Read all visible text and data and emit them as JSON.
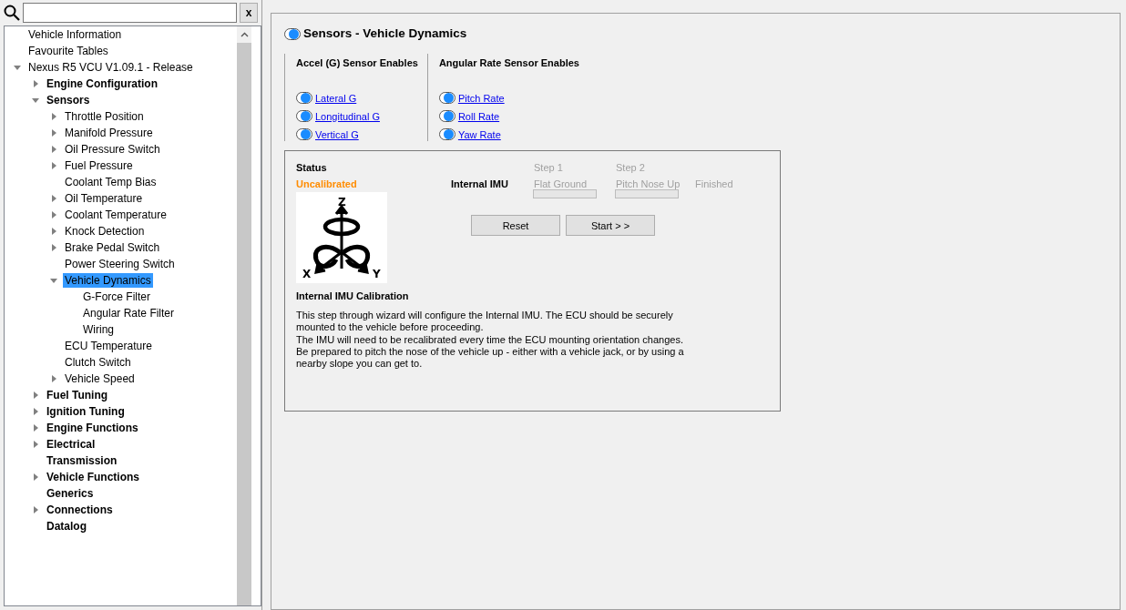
{
  "search": {
    "clear_label": "x"
  },
  "tree": [
    {
      "label": "Vehicle Information",
      "selected": false
    },
    {
      "label": "Favourite Tables",
      "selected": false
    },
    {
      "label": "Nexus R5 VCU V1.09.1 - Release",
      "selected": false,
      "expanded": true,
      "children": [
        {
          "label": "Engine Configuration",
          "selected": false,
          "expanded": false
        },
        {
          "label": "Sensors",
          "selected": false,
          "expanded": true,
          "children": [
            {
              "label": "Throttle Position",
              "selected": false,
              "expanded": false
            },
            {
              "label": "Manifold Pressure",
              "selected": false,
              "expanded": false
            },
            {
              "label": "Oil Pressure Switch",
              "selected": false,
              "expanded": false
            },
            {
              "label": "Fuel Pressure",
              "selected": false,
              "expanded": false
            },
            {
              "label": "Coolant Temp Bias",
              "selected": false
            },
            {
              "label": "Oil Temperature",
              "selected": false,
              "expanded": false
            },
            {
              "label": "Coolant Temperature",
              "selected": false,
              "expanded": false
            },
            {
              "label": "Knock Detection",
              "selected": false,
              "expanded": false
            },
            {
              "label": "Brake Pedal Switch",
              "selected": false,
              "expanded": false
            },
            {
              "label": "Power Steering Switch",
              "selected": false
            },
            {
              "label": "Vehicle Dynamics",
              "selected": true,
              "expanded": true,
              "children": [
                {
                  "label": "G-Force Filter",
                  "selected": false
                },
                {
                  "label": "Angular Rate Filter",
                  "selected": false
                },
                {
                  "label": "Wiring",
                  "selected": false
                }
              ]
            },
            {
              "label": "ECU Temperature",
              "selected": false
            },
            {
              "label": "Clutch Switch",
              "selected": false
            },
            {
              "label": "Vehicle Speed",
              "selected": false,
              "expanded": false
            }
          ]
        },
        {
          "label": "Fuel Tuning",
          "selected": false,
          "expanded": false
        },
        {
          "label": "Ignition Tuning",
          "selected": false,
          "expanded": false
        },
        {
          "label": "Engine Functions",
          "selected": false,
          "expanded": false
        },
        {
          "label": "Electrical",
          "selected": false,
          "expanded": false
        },
        {
          "label": "Transmission",
          "selected": false
        },
        {
          "label": "Vehicle Functions",
          "selected": false,
          "expanded": false
        },
        {
          "label": "Generics",
          "selected": false
        },
        {
          "label": "Connections",
          "selected": false,
          "expanded": false
        },
        {
          "label": "Datalog",
          "selected": false
        }
      ]
    }
  ],
  "page": {
    "title": "Sensors - Vehicle Dynamics",
    "title_on": true,
    "groups": [
      {
        "heading": "Accel (G) Sensor Enables",
        "toggles": [
          {
            "label": "Lateral G",
            "on": true
          },
          {
            "label": "Longitudinal G",
            "on": true
          },
          {
            "label": "Vertical G",
            "on": true
          }
        ]
      },
      {
        "heading": "Angular Rate Sensor Enables",
        "toggles": [
          {
            "label": "Pitch Rate",
            "on": true
          },
          {
            "label": "Roll Rate",
            "on": true
          },
          {
            "label": "Yaw Rate",
            "on": true
          }
        ]
      }
    ],
    "calibration": {
      "status_label": "Status",
      "status_value": "Uncalibrated",
      "device": "Internal IMU",
      "steps": [
        {
          "step": "Step 1",
          "label": "Flat Ground",
          "disabled": true,
          "level": 0
        },
        {
          "step": "Step 2",
          "label": "Pitch Nose Up",
          "disabled": true,
          "level": 0
        }
      ],
      "finished": {
        "label": "Finished",
        "disabled": true
      },
      "buttons": [
        "Reset",
        "Start > >"
      ],
      "diagram_labels": {
        "z": "Z",
        "x": "X",
        "y": "Y"
      },
      "heading": "Internal IMU Calibration",
      "paragraphs": [
        "This step through wizard will configure the Internal IMU. The ECU should be securely mounted to the vehicle before proceeding.",
        "The IMU will need to be recalibrated every time the ECU mounting orientation changes. Be prepared to pitch the nose of the vehicle up - either with a vehicle jack, or by using a nearby slope you can get to."
      ]
    }
  }
}
